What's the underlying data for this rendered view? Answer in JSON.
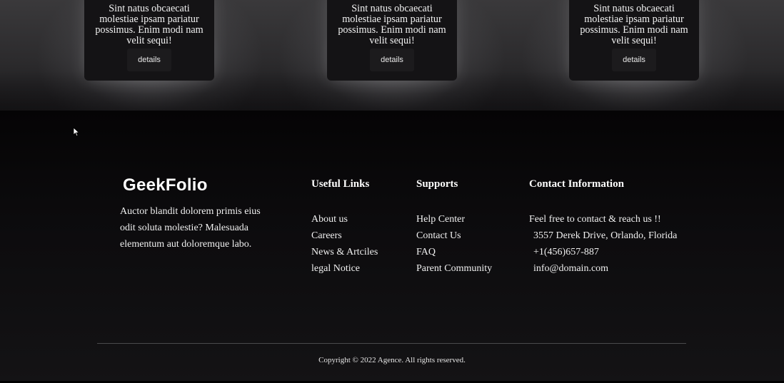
{
  "cards": [
    {
      "text": "Sint natus obcaecati molestiae ipsam pariatur possimus. Enim modi nam velit sequi!",
      "button": "details"
    },
    {
      "text": "Sint natus obcaecati molestiae ipsam pariatur possimus. Enim modi nam velit sequi!",
      "button": "details"
    },
    {
      "text": "Sint natus obcaecati molestiae ipsam pariatur possimus. Enim modi nam velit sequi!",
      "button": "details"
    }
  ],
  "footer": {
    "logo": "GeekFolio",
    "about": "Auctor blandit dolorem primis eius odit soluta molestie? Malesuada elementum aut doloremque labo.",
    "useful_links": {
      "title": "Useful Links",
      "items": [
        "About us",
        "Careers",
        "News & Artciles",
        "legal Notice"
      ]
    },
    "supports": {
      "title": "Supports",
      "items": [
        "Help Center",
        "Contact Us",
        "FAQ",
        "Parent Community"
      ]
    },
    "contact": {
      "title": "Contact Information",
      "intro": "Feel free to contact & reach us !!",
      "address": "3557 Derek Drive, Orlando, Florida",
      "phone": "+1(456)657-887",
      "email": "info@domain.com"
    },
    "copyright": "Copyright © 2022 Agence. All rights reserved."
  },
  "icons": {
    "cursor": "mouse-pointer-icon"
  },
  "colors": {
    "background": "#0b0a0b",
    "card": "#141315",
    "text": "#ffffff"
  }
}
